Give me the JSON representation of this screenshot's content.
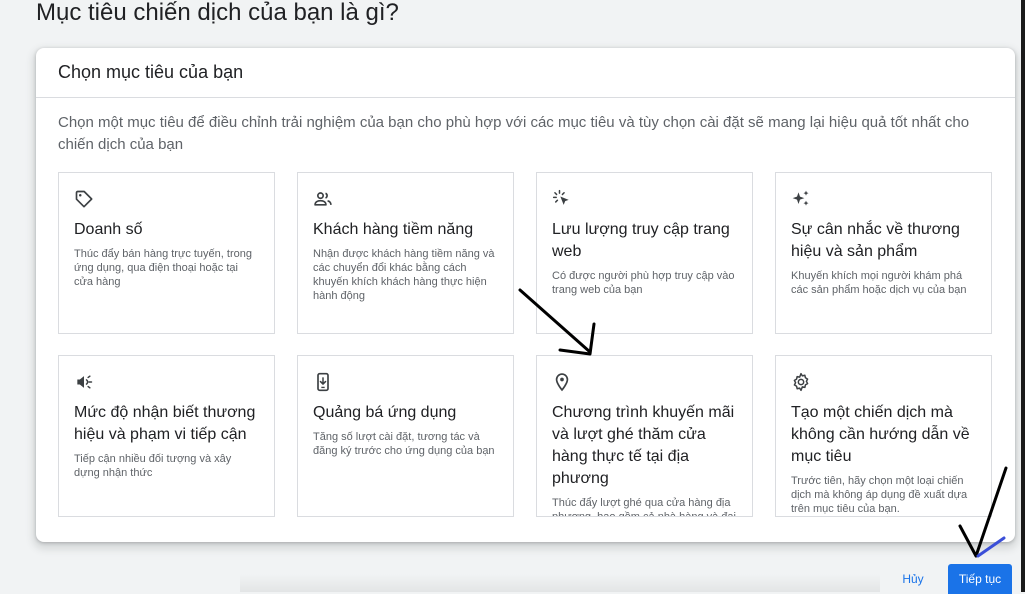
{
  "page": {
    "title": "Mục tiêu chiến dịch của bạn là gì?"
  },
  "card": {
    "title": "Chọn mục tiêu của bạn",
    "description": "Chọn một mục tiêu để điều chỉnh trải nghiệm của bạn cho phù hợp với các mục tiêu và tùy chọn cài đặt sẽ mang lại hiệu quả tốt nhất cho chiến dịch của bạn"
  },
  "goals": [
    {
      "icon": "tag-icon",
      "title": "Doanh số",
      "description": "Thúc đẩy bán hàng trực tuyến, trong ứng dụng, qua điện thoại hoặc tại cửa hàng"
    },
    {
      "icon": "people-icon",
      "title": "Khách hàng tiềm năng",
      "description": "Nhận được khách hàng tiềm năng và các chuyển đổi khác bằng cách khuyến khích khách hàng thực hiện hành động"
    },
    {
      "icon": "cursor-click-icon",
      "title": "Lưu lượng truy cập trang web",
      "description": "Có được người phù hợp truy cập vào trang web của bạn"
    },
    {
      "icon": "sparkle-icon",
      "title": "Sự cân nhắc về thương hiệu và sản phẩm",
      "description": "Khuyến khích mọi người khám phá các sản phẩm hoặc dịch vụ của bạn"
    },
    {
      "icon": "megaphone-icon",
      "title": "Mức độ nhận biết thương hiệu và phạm vi tiếp cận",
      "description": "Tiếp cận nhiều đối tượng và xây dựng nhận thức"
    },
    {
      "icon": "phone-download-icon",
      "title": "Quảng bá ứng dụng",
      "description": "Tăng số lượt cài đặt, tương tác và đăng ký trước cho ứng dụng của bạn"
    },
    {
      "icon": "location-pin-icon",
      "title": "Chương trình khuyến mãi và lượt ghé thăm cửa hàng thực tế tại địa phương",
      "description": "Thúc đẩy lượt ghé qua cửa hàng địa phương, bao gồm cả nhà hàng và đại lý."
    },
    {
      "icon": "gear-icon",
      "title": "Tạo một chiến dịch mà không cần hướng dẫn về mục tiêu",
      "description": "Trước tiên, hãy chọn một loại chiến dịch mà không áp dụng đề xuất dựa trên mục tiêu của bạn."
    }
  ],
  "actions": {
    "cancel_label": "Hủy",
    "continue_label": "Tiếp tục"
  },
  "colors": {
    "accent": "#1a73e8",
    "annotation": "#000000"
  }
}
